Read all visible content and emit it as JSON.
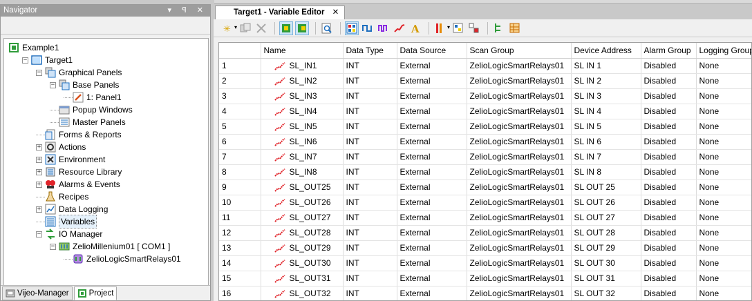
{
  "navigator": {
    "title": "Navigator",
    "title_buttons": "▾ ꟼ ✕",
    "tree": [
      {
        "label": "Example1",
        "level": 0,
        "icon": "project-icon",
        "expander": ""
      },
      {
        "label": "Target1",
        "level": 1,
        "icon": "target-icon",
        "expander": "−"
      },
      {
        "label": "Graphical Panels",
        "level": 2,
        "icon": "panels-icon",
        "expander": "−"
      },
      {
        "label": "Base Panels",
        "level": 3,
        "icon": "panels-icon",
        "expander": "−"
      },
      {
        "label": "1: Panel1",
        "level": 4,
        "icon": "panel-edit-icon",
        "expander": ""
      },
      {
        "label": "Popup Windows",
        "level": 3,
        "icon": "popup-window-icon",
        "expander": ""
      },
      {
        "label": "Master Panels",
        "level": 3,
        "icon": "master-panel-icon",
        "expander": ""
      },
      {
        "label": "Forms & Reports",
        "level": 2,
        "icon": "forms-icon",
        "expander": ""
      },
      {
        "label": "Actions",
        "level": 2,
        "icon": "actions-icon",
        "expander": "+"
      },
      {
        "label": "Environment",
        "level": 2,
        "icon": "environment-icon",
        "expander": "+"
      },
      {
        "label": "Resource Library",
        "level": 2,
        "icon": "resource-library-icon",
        "expander": "+"
      },
      {
        "label": "Alarms & Events",
        "level": 2,
        "icon": "alarms-icon",
        "expander": "+"
      },
      {
        "label": "Recipes",
        "level": 2,
        "icon": "recipes-icon",
        "expander": ""
      },
      {
        "label": "Data Logging",
        "level": 2,
        "icon": "data-logging-icon",
        "expander": "+"
      },
      {
        "label": "Variables",
        "level": 2,
        "icon": "variables-icon",
        "expander": ""
      },
      {
        "label": "IO Manager",
        "level": 2,
        "icon": "io-manager-icon",
        "expander": "−"
      },
      {
        "label": "ZelioMillenium01 [ COM1 ]",
        "level": 3,
        "icon": "driver-icon",
        "expander": "−"
      },
      {
        "label": "ZelioLogicSmartRelays01",
        "level": 4,
        "icon": "equipment-icon",
        "expander": ""
      }
    ],
    "bottom_tabs": [
      "Vijeo-Manager",
      "Project"
    ]
  },
  "editor": {
    "tab_title": "Target1 - Variable Editor",
    "tab_close": "✕",
    "columns": [
      "",
      "Name",
      "Data Type",
      "Data Source",
      "Scan Group",
      "Device Address",
      "Alarm Group",
      "Logging Group"
    ],
    "rows": [
      [
        "1",
        "SL_IN1",
        "INT",
        "External",
        "ZelioLogicSmartRelays01",
        "SL IN 1",
        "Disabled",
        "None"
      ],
      [
        "2",
        "SL_IN2",
        "INT",
        "External",
        "ZelioLogicSmartRelays01",
        "SL IN 2",
        "Disabled",
        "None"
      ],
      [
        "3",
        "SL_IN3",
        "INT",
        "External",
        "ZelioLogicSmartRelays01",
        "SL IN 3",
        "Disabled",
        "None"
      ],
      [
        "4",
        "SL_IN4",
        "INT",
        "External",
        "ZelioLogicSmartRelays01",
        "SL IN 4",
        "Disabled",
        "None"
      ],
      [
        "5",
        "SL_IN5",
        "INT",
        "External",
        "ZelioLogicSmartRelays01",
        "SL IN 5",
        "Disabled",
        "None"
      ],
      [
        "6",
        "SL_IN6",
        "INT",
        "External",
        "ZelioLogicSmartRelays01",
        "SL IN 6",
        "Disabled",
        "None"
      ],
      [
        "7",
        "SL_IN7",
        "INT",
        "External",
        "ZelioLogicSmartRelays01",
        "SL IN 7",
        "Disabled",
        "None"
      ],
      [
        "8",
        "SL_IN8",
        "INT",
        "External",
        "ZelioLogicSmartRelays01",
        "SL IN 8",
        "Disabled",
        "None"
      ],
      [
        "9",
        "SL_OUT25",
        "INT",
        "External",
        "ZelioLogicSmartRelays01",
        "SL OUT 25",
        "Disabled",
        "None"
      ],
      [
        "10",
        "SL_OUT26",
        "INT",
        "External",
        "ZelioLogicSmartRelays01",
        "SL OUT 26",
        "Disabled",
        "None"
      ],
      [
        "11",
        "SL_OUT27",
        "INT",
        "External",
        "ZelioLogicSmartRelays01",
        "SL OUT 27",
        "Disabled",
        "None"
      ],
      [
        "12",
        "SL_OUT28",
        "INT",
        "External",
        "ZelioLogicSmartRelays01",
        "SL OUT 28",
        "Disabled",
        "None"
      ],
      [
        "13",
        "SL_OUT29",
        "INT",
        "External",
        "ZelioLogicSmartRelays01",
        "SL OUT 29",
        "Disabled",
        "None"
      ],
      [
        "14",
        "SL_OUT30",
        "INT",
        "External",
        "ZelioLogicSmartRelays01",
        "SL OUT 30",
        "Disabled",
        "None"
      ],
      [
        "15",
        "SL_OUT31",
        "INT",
        "External",
        "ZelioLogicSmartRelays01",
        "SL OUT 31",
        "Disabled",
        "None"
      ],
      [
        "16",
        "SL_OUT32",
        "INT",
        "External",
        "ZelioLogicSmartRelays01",
        "SL OUT 32",
        "Disabled",
        "None"
      ]
    ]
  },
  "colors": {
    "accent": "#1e90d6",
    "variable_icon": "#e0242a",
    "title_bar": "#9d9d9d"
  }
}
